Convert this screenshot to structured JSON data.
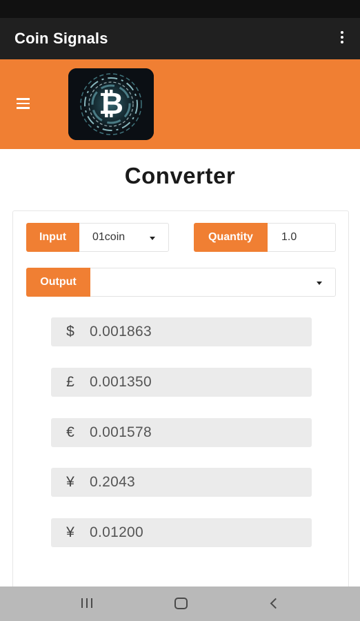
{
  "app_bar": {
    "title": "Coin Signals"
  },
  "banner": {
    "logo_icon": "bitcoin-logo-icon"
  },
  "page": {
    "title": "Converter"
  },
  "converter": {
    "input": {
      "label": "Input",
      "selected": "01coin"
    },
    "quantity": {
      "label": "Quantity",
      "value": "1.0"
    },
    "output": {
      "label": "Output",
      "selected": ""
    },
    "results": [
      {
        "symbol": "$",
        "value": "0.001863"
      },
      {
        "symbol": "£",
        "value": "0.001350"
      },
      {
        "symbol": "€",
        "value": "0.001578"
      },
      {
        "symbol": "¥",
        "value": "0.2043"
      },
      {
        "symbol": "¥",
        "value": "0.01200"
      }
    ]
  },
  "colors": {
    "accent": "#f07f33",
    "app_bar": "#202020",
    "result_bg": "#ebebeb"
  },
  "icons": {
    "overflow": "more-vert-icon",
    "menu": "menu-icon",
    "dropdown": "caret-down-icon",
    "nav_recents": "recents-icon",
    "nav_home": "home-icon",
    "nav_back": "back-icon"
  }
}
